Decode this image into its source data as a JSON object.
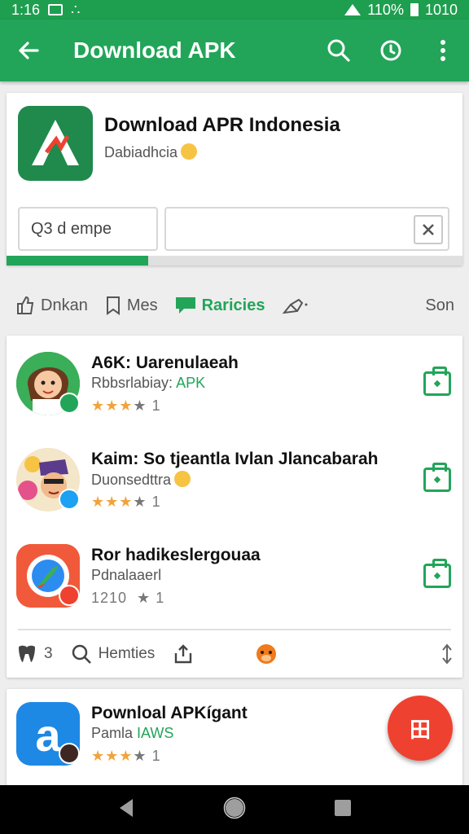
{
  "status_bar": {
    "time": "1:16",
    "battery": "110%",
    "right_text": "1010"
  },
  "app_bar": {
    "title": "Download APK"
  },
  "hero": {
    "title": "Download APR Indonesia",
    "subtitle": "Dabiadhcia",
    "input_value": "Q3 d empe",
    "progress_percent": 31
  },
  "tabs": [
    {
      "label": "Dnkan",
      "icon": "thumb-icon"
    },
    {
      "label": "Mes",
      "icon": "bookmark-icon"
    },
    {
      "label": "Raricies",
      "icon": "chat-icon",
      "active": true
    },
    {
      "label": "",
      "icon": "pin-icon"
    },
    {
      "label": "Son",
      "icon": ""
    }
  ],
  "apps": [
    {
      "title": "A6K: Uarenulaeah",
      "subtitle": "Rbbsrlabiay:",
      "accent": "APK",
      "rating_text": "1"
    },
    {
      "title": "Kaim: So tjeantla Ivlan Jlancabarah",
      "subtitle": "Duonsedttra",
      "accent": "",
      "rating_text": "1"
    },
    {
      "title": "Ror hadikeslergouaa",
      "subtitle": "Pdnalaaerl",
      "accent": "",
      "rating_text": "1",
      "rating_prefix": "1210  "
    }
  ],
  "list_footer": {
    "count": "3",
    "label": "Hemties"
  },
  "next_app": {
    "title": "Pownloal APKígant",
    "subtitle": "Pamla",
    "accent": "IAWS",
    "rating_text": "1"
  },
  "fab": {
    "label": "田"
  },
  "colors": {
    "primary": "#22a559",
    "fab": "#ef4130",
    "star": "#f2a23a"
  }
}
